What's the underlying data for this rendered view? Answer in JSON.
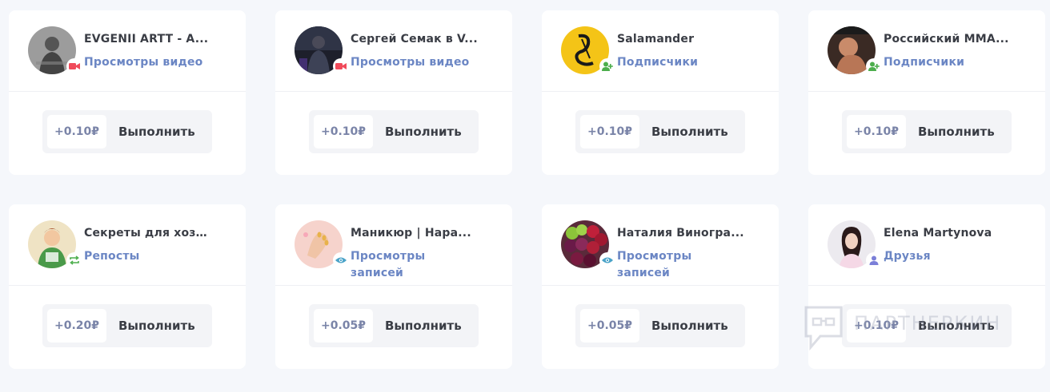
{
  "cards": [
    {
      "title": "EVGENII ARTT - A...",
      "subtitle": "Просмотры видео",
      "price": "+0.10₽",
      "action": "Выполнить",
      "badge_icon": "video-camera-icon",
      "badge_color": "#f04a5a"
    },
    {
      "title": "Сергей Семак в V...",
      "subtitle": "Просмотры видео",
      "price": "+0.10₽",
      "action": "Выполнить",
      "badge_icon": "video-camera-icon",
      "badge_color": "#f04a5a"
    },
    {
      "title": "Salamander",
      "subtitle": "Подписчики",
      "price": "+0.10₽",
      "action": "Выполнить",
      "badge_icon": "add-user-icon",
      "badge_color": "#4cae4c"
    },
    {
      "title": "Российский MMA...",
      "subtitle": "Подписчики",
      "price": "+0.10₽",
      "action": "Выполнить",
      "badge_icon": "add-user-icon",
      "badge_color": "#4cae4c"
    },
    {
      "title": "Секреты для хозя...",
      "subtitle": "Репосты",
      "price": "+0.20₽",
      "action": "Выполнить",
      "badge_icon": "repost-icon",
      "badge_color": "#4cae4c"
    },
    {
      "title": "Маникюр | Нара...",
      "subtitle": "Просмотры записей",
      "price": "+0.05₽",
      "action": "Выполнить",
      "badge_icon": "eye-icon",
      "badge_color": "#4aa3c8"
    },
    {
      "title": "Наталия Виногра...",
      "subtitle": "Просмотры записей",
      "price": "+0.05₽",
      "action": "Выполнить",
      "badge_icon": "eye-icon",
      "badge_color": "#4aa3c8"
    },
    {
      "title": "Elena Martynova",
      "subtitle": "Друзья",
      "price": "+0.10₽",
      "action": "Выполнить",
      "badge_icon": "user-icon",
      "badge_color": "#7b7fd8"
    }
  ],
  "watermark": {
    "text": "ПАРТНЕРКИН"
  },
  "colors": {
    "accent": "#6b86c4",
    "background": "#f5f7fb",
    "card": "#ffffff"
  }
}
